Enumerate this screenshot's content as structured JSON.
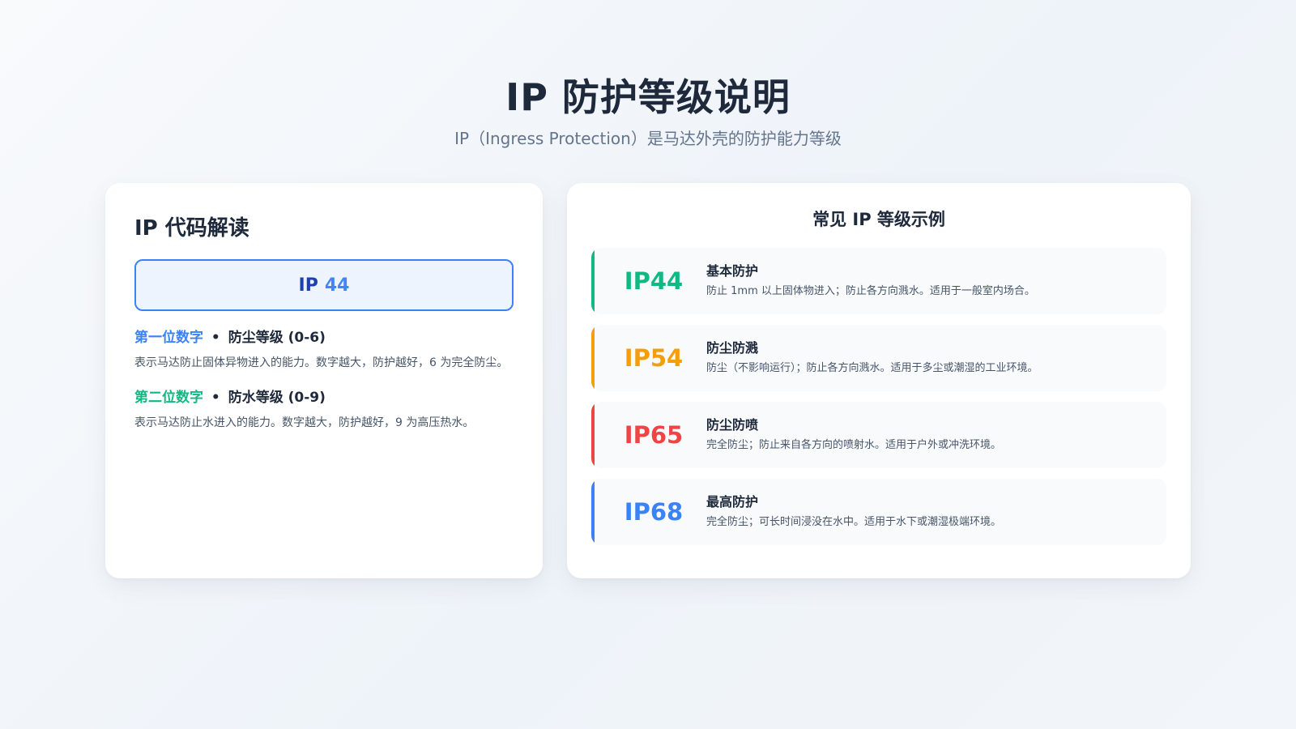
{
  "header": {
    "title": "IP 防护等级说明",
    "subtitle": "IP（Ingress Protection）是马达外壳的防护能力等级"
  },
  "decoder": {
    "title": "IP 代码解读",
    "ip_prefix": "IP",
    "ip_digits": "44",
    "first_digit": {
      "label": "第一位数字",
      "separator": "•",
      "range": "防尘等级 (0-6)",
      "description": "表示马达防止固体异物进入的能力。数字越大，防护越好，6 为完全防尘。"
    },
    "second_digit": {
      "label": "第二位数字",
      "separator": "•",
      "range": "防水等级 (0-9)",
      "description": "表示马达防止水进入的能力。数字越大，防护越好，9 为高压热水。"
    }
  },
  "examples": {
    "title": "常见 IP 等级示例",
    "items": [
      {
        "code": "IP44",
        "name": "基本防护",
        "description": "防止 1mm 以上固体物进入；防止各方向溅水。适用于一般室内场合。",
        "color": "#10b981"
      },
      {
        "code": "IP54",
        "name": "防尘防溅",
        "description": "防尘（不影响运行）；防止各方向溅水。适用于多尘或潮湿的工业环境。",
        "color": "#f59e0b"
      },
      {
        "code": "IP65",
        "name": "防尘防喷",
        "description": "完全防尘；防止来自各方向的喷射水。适用于户外或冲洗环境。",
        "color": "#ef4444"
      },
      {
        "code": "IP68",
        "name": "最高防护",
        "description": "完全防尘；可长时间浸没在水中。适用于水下或潮湿极端环境。",
        "color": "#3b82f6"
      }
    ]
  },
  "colors": {
    "accent_blue": "#3b82f6",
    "accent_green": "#10b981",
    "text_dark": "#1e293b",
    "text_muted": "#64748b"
  }
}
